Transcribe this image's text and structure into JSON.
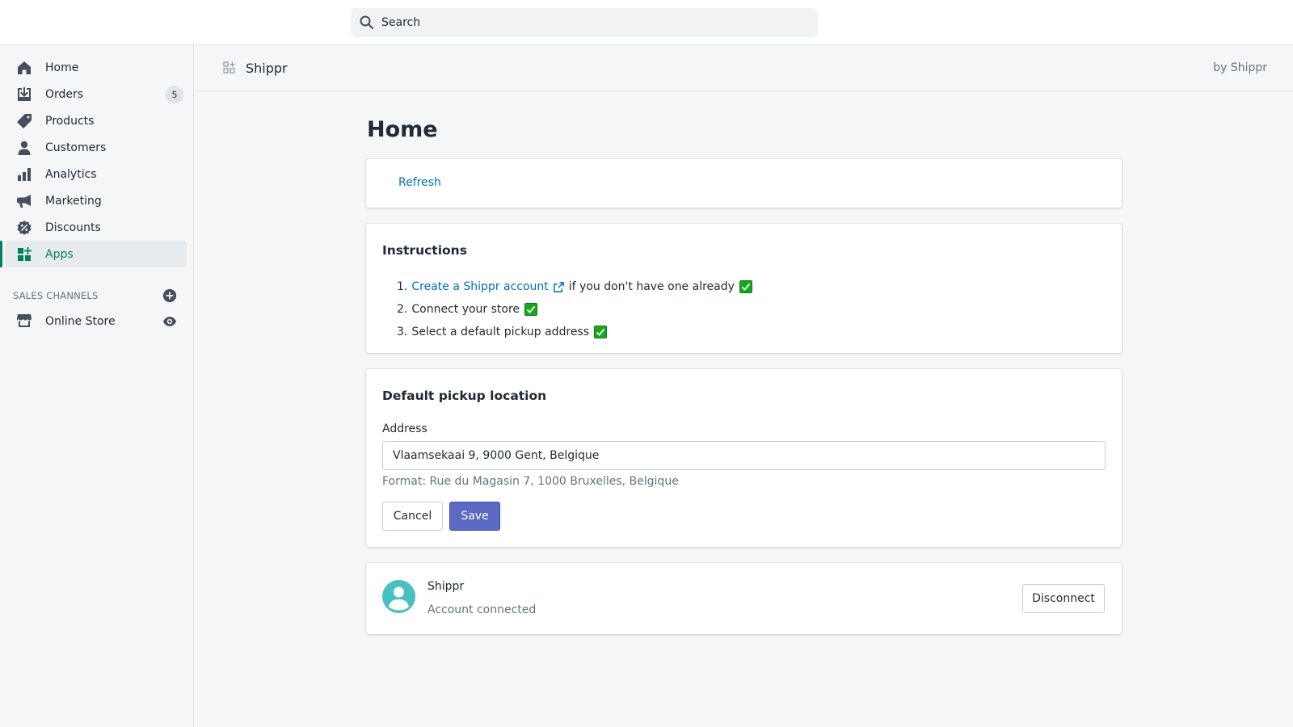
{
  "search": {
    "placeholder": "Search"
  },
  "sidebar": {
    "items": [
      {
        "label": "Home",
        "icon": "home-icon"
      },
      {
        "label": "Orders",
        "icon": "orders-icon",
        "badge": "5"
      },
      {
        "label": "Products",
        "icon": "tag-icon"
      },
      {
        "label": "Customers",
        "icon": "person-icon"
      },
      {
        "label": "Analytics",
        "icon": "bar-chart-icon"
      },
      {
        "label": "Marketing",
        "icon": "megaphone-icon"
      },
      {
        "label": "Discounts",
        "icon": "discount-icon"
      },
      {
        "label": "Apps",
        "icon": "apps-icon",
        "active": true
      }
    ],
    "channels_title": "SALES CHANNELS",
    "online_store": "Online Store"
  },
  "appbar": {
    "name": "Shippr",
    "by": "by Shippr"
  },
  "page": {
    "title": "Home"
  },
  "refresh_card": {
    "link": "Refresh"
  },
  "instructions": {
    "title": "Instructions",
    "steps": [
      {
        "num": "1.",
        "link": "Create a Shippr account",
        "text": "if you don't have one already"
      },
      {
        "num": "2.",
        "text": "Connect your store"
      },
      {
        "num": "3.",
        "text": "Select a default pickup address"
      }
    ]
  },
  "pickup": {
    "title": "Default pickup location",
    "label": "Address",
    "value": "Vlaamsekaai 9, 9000 Gent, Belgique",
    "help": "Format: Rue du Magasin 7, 1000 Bruxelles, Belgique",
    "cancel": "Cancel",
    "save": "Save"
  },
  "account": {
    "name": "Shippr",
    "status": "Account connected",
    "disconnect": "Disconnect"
  },
  "colors": {
    "accent": "#008060",
    "primary_button": "#5c6ac4",
    "link": "#006fbb",
    "avatar": "#47c1bf",
    "check": "#17a81f"
  }
}
